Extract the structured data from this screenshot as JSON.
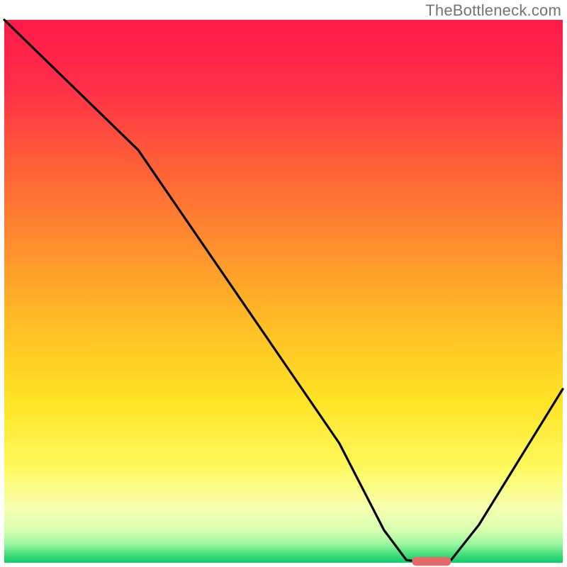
{
  "watermark": "TheBottleneck.com",
  "chart_data": {
    "type": "line",
    "title": "",
    "xlabel": "",
    "ylabel": "",
    "xlim": [
      0,
      100
    ],
    "ylim": [
      0,
      100
    ],
    "axes_visible": false,
    "grid": false,
    "background_gradient": {
      "stops": [
        {
          "offset": 0.0,
          "color": "#ff1a4a"
        },
        {
          "offset": 0.12,
          "color": "#ff2e48"
        },
        {
          "offset": 0.25,
          "color": "#ff5a3a"
        },
        {
          "offset": 0.4,
          "color": "#ff8a2e"
        },
        {
          "offset": 0.55,
          "color": "#ffba25"
        },
        {
          "offset": 0.7,
          "color": "#ffe325"
        },
        {
          "offset": 0.82,
          "color": "#fff85a"
        },
        {
          "offset": 0.9,
          "color": "#f6ffb0"
        },
        {
          "offset": 0.94,
          "color": "#d6ffb0"
        },
        {
          "offset": 0.965,
          "color": "#9cf7a0"
        },
        {
          "offset": 0.985,
          "color": "#43de7a"
        },
        {
          "offset": 1.0,
          "color": "#11c96b"
        }
      ]
    },
    "curve": {
      "x": [
        0,
        10,
        20,
        24,
        30,
        40,
        50,
        60,
        68,
        72,
        76,
        80,
        85,
        100
      ],
      "y": [
        100,
        90,
        80,
        76,
        67,
        52,
        37,
        22,
        6,
        0.5,
        0,
        0.5,
        7,
        32
      ]
    },
    "marker": {
      "x_start": 73,
      "x_end": 80,
      "y": 0,
      "color": "#e46a6a",
      "thickness_pct": 1.6
    }
  }
}
